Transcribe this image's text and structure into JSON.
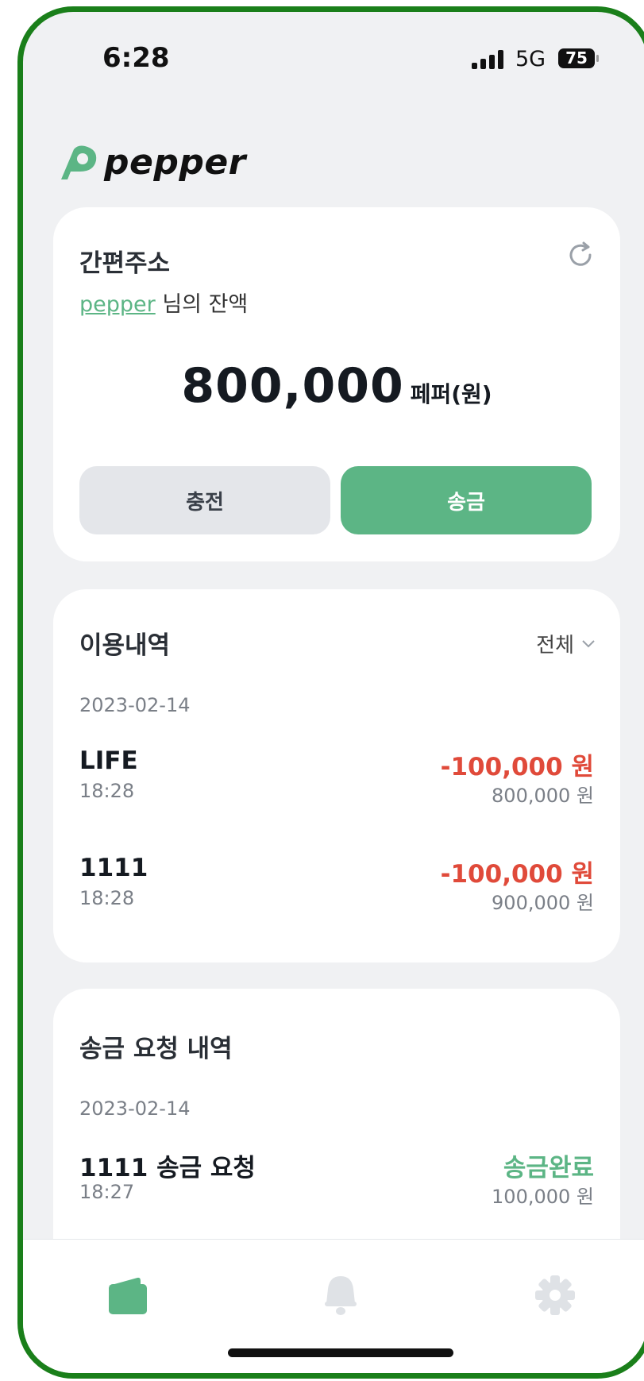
{
  "status_bar": {
    "time": "6:28",
    "network": "5G",
    "battery": "75"
  },
  "brand": {
    "name": "pepper",
    "color": "#5cb585"
  },
  "wallet": {
    "title": "간편주소",
    "user_link": "pepper",
    "user_suffix": " 님의 잔액",
    "balance": "800,000",
    "unit": "페퍼(원)",
    "charge_label": "충전",
    "send_label": "송금"
  },
  "history": {
    "title": "이용내역",
    "filter": "전체",
    "date": "2023-02-14",
    "items": [
      {
        "name": "LIFE",
        "time": "18:28",
        "amount": "-100,000 원",
        "balance": "800,000 원"
      },
      {
        "name": "1111",
        "time": "18:28",
        "amount": "-100,000 원",
        "balance": "900,000 원"
      }
    ]
  },
  "requests": {
    "title": "송금 요청 내역",
    "date": "2023-02-14",
    "items": [
      {
        "name": "1111 송금 요청",
        "time": "18:27",
        "status": "송금완료",
        "amount": "100,000 원"
      }
    ]
  },
  "tabs": [
    {
      "icon": "wallet-icon",
      "active": true
    },
    {
      "icon": "bell-icon",
      "active": false
    },
    {
      "icon": "gear-icon",
      "active": false
    }
  ],
  "colors": {
    "accent": "#5cb585",
    "negative": "#e04a3a",
    "frame": "#1a7f1a"
  }
}
